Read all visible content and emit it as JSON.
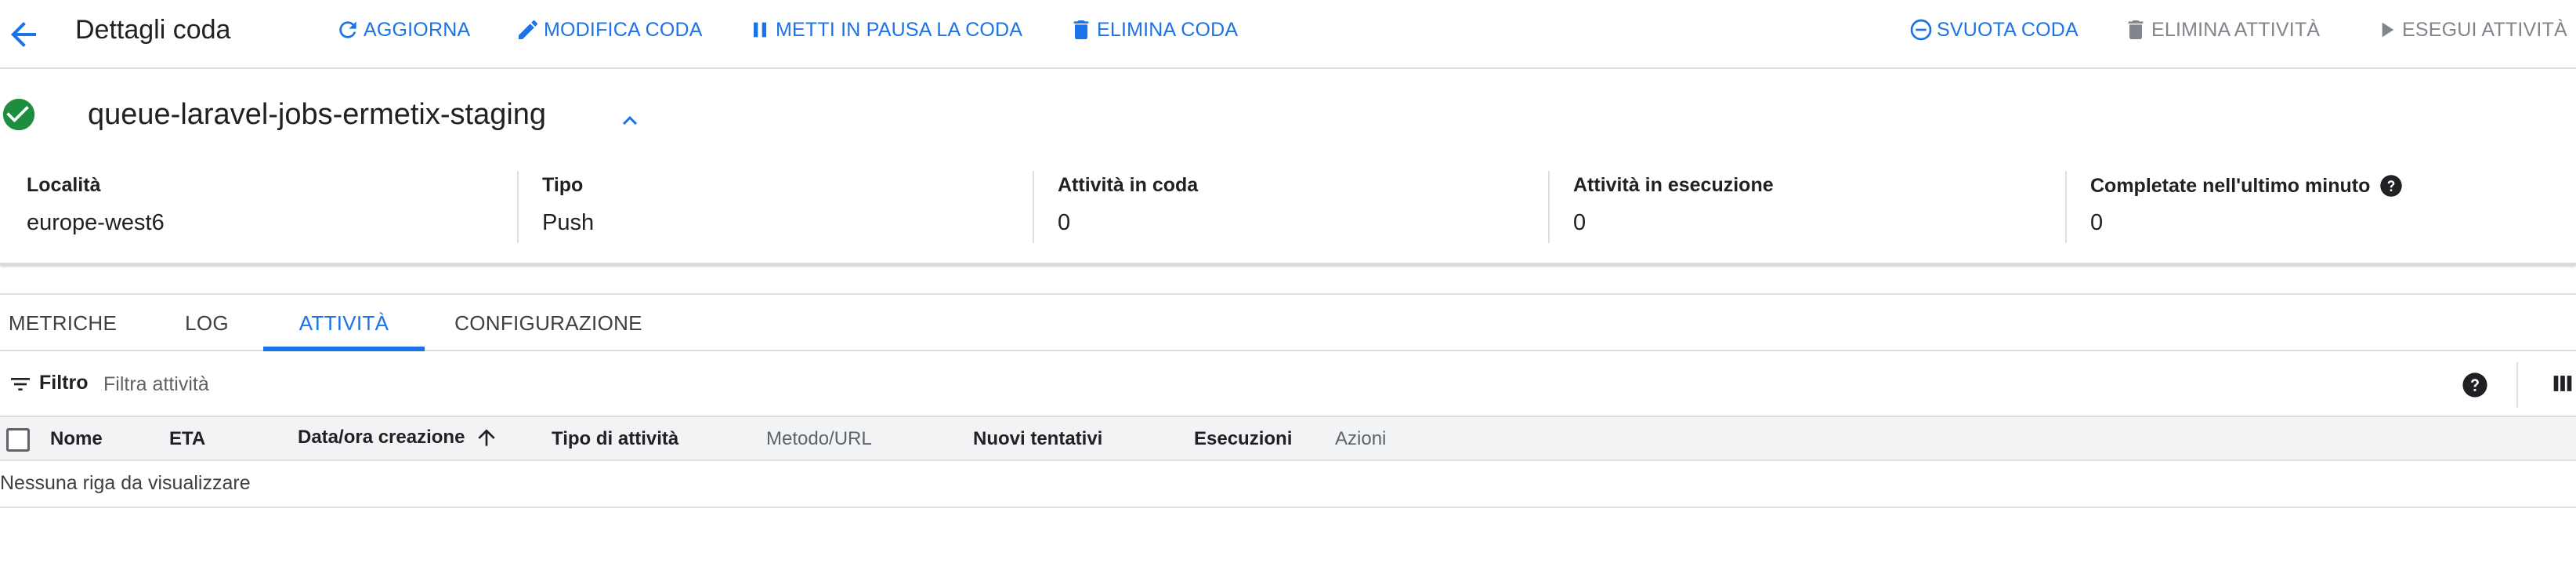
{
  "header": {
    "title": "Dettagli coda",
    "actions": {
      "refresh": "AGGIORNA",
      "edit": "MODIFICA CODA",
      "pause": "METTI IN PAUSA LA CODA",
      "delete": "ELIMINA CODA",
      "purge": "SVUOTA CODA",
      "delete_tasks": "ELIMINA ATTIVITÀ",
      "run_tasks": "ESEGUI ATTIVITÀ"
    }
  },
  "queue": {
    "name": "queue-laravel-jobs-ermetix-staging",
    "status_icon": "check-circle-icon",
    "details": [
      {
        "label": "Località",
        "value": "europe-west6"
      },
      {
        "label": "Tipo",
        "value": "Push"
      },
      {
        "label": "Attività in coda",
        "value": "0"
      },
      {
        "label": "Attività in esecuzione",
        "value": "0"
      },
      {
        "label": "Completate nell'ultimo minuto",
        "value": "0"
      }
    ]
  },
  "tabs": {
    "metrics": "METRICHE",
    "logs": "LOG",
    "tasks": "ATTIVITÀ",
    "config": "CONFIGURAZIONE",
    "active": "ATTIVITÀ"
  },
  "filter": {
    "label": "Filtro",
    "placeholder": "Filtra attività"
  },
  "table": {
    "columns": {
      "name": "Nome",
      "eta": "ETA",
      "created": "Data/ora creazione",
      "type": "Tipo di attività",
      "method": "Metodo/URL",
      "retries": "Nuovi tentativi",
      "executions": "Esecuzioni",
      "actions": "Azioni"
    },
    "empty_message": "Nessuna riga da visualizzare"
  },
  "colors": {
    "accent": "#1a73e8",
    "success": "#1e8e3e",
    "disabled": "#80868b"
  }
}
